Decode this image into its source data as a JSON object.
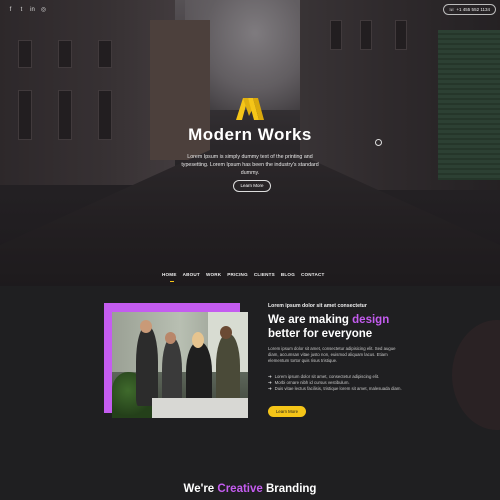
{
  "topbar": {
    "social": [
      {
        "icon": "facebook-icon",
        "glyph": "f"
      },
      {
        "icon": "twitter-icon",
        "glyph": "t"
      },
      {
        "icon": "linkedin-icon",
        "glyph": "in"
      },
      {
        "icon": "instagram-icon",
        "glyph": "◎"
      }
    ],
    "phone": "+1 455 552 1134"
  },
  "hero": {
    "title": "Modern Works",
    "description": "Lorem Ipsum is simply dummy text of the printing and typesetting. Lorem Ipsum has been the industry's standard dummy.",
    "button_label": "Learn More"
  },
  "nav": {
    "items": [
      "HOME",
      "ABOUT",
      "WORK",
      "PRICING",
      "CLIENTS",
      "BLOG",
      "CONTACT"
    ],
    "active": "HOME"
  },
  "about": {
    "kicker": "Lorem ipsum dolor sit amet consectetur",
    "title_start": "We are making ",
    "title_highlight": "design",
    "title_end": "better for everyone",
    "body": "Lorem ipsum dolor sit amet, consectetur adipisicing elit. Sed augue diam, accumsan vitae justo non, euismod aliquam lacus. Etiam elementum tortor quis risus tristique.",
    "list": [
      "Lorem ipsum dolor sit amet, consectetur adipiscing elit.",
      "Morbi ornare nibh id cursus vestibulum.",
      "Duis vitae lectus facilisis, tristique lorem sit amet, malesuada diam."
    ],
    "button_label": "Learn More"
  },
  "section2": {
    "title_start": "We're ",
    "title_highlight": "Creative",
    "title_end": " Branding"
  },
  "colors": {
    "accent_purple": "#c45cf0",
    "accent_yellow": "#f5c518",
    "background": "#1f1f21"
  }
}
